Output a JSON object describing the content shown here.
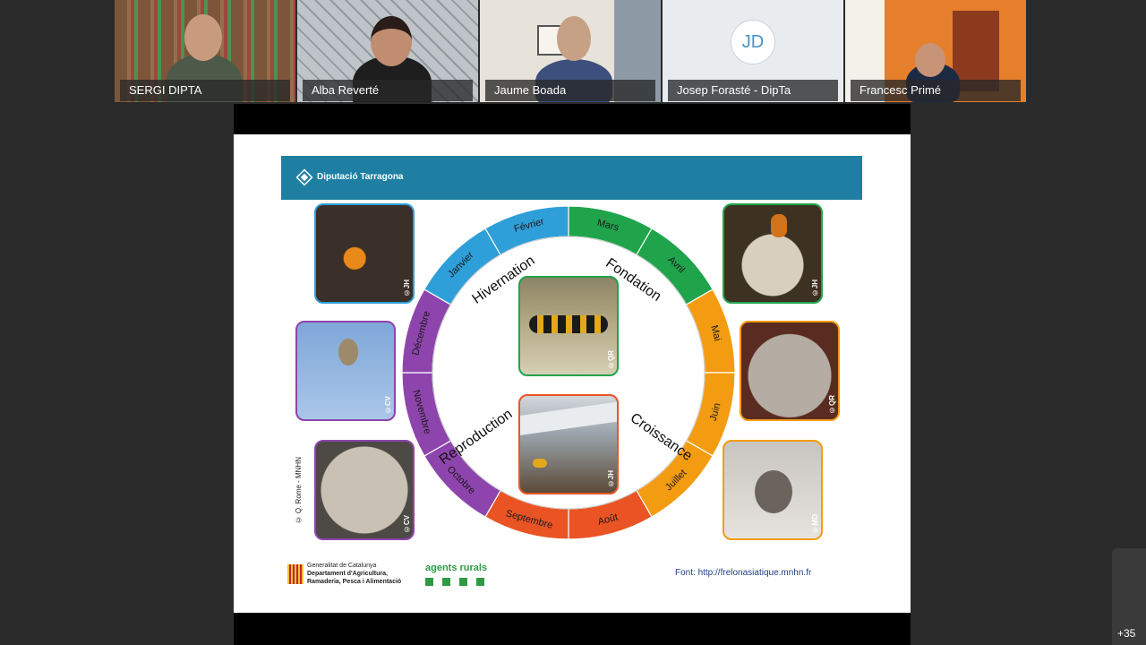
{
  "participants": [
    {
      "name": "SERGI DIPTA"
    },
    {
      "name": "Alba Reverté"
    },
    {
      "name": "Jaume Boada"
    },
    {
      "name": "Josep Forasté - DipTa",
      "initials": "JD"
    },
    {
      "name": "Francesc Primé"
    }
  ],
  "overflow_count": "+35",
  "slide": {
    "banner": "Diputació Tarragona",
    "months": [
      "Mars",
      "Avril",
      "Mai",
      "Juin",
      "Juillet",
      "Août",
      "Septembre",
      "Octobre",
      "Novembre",
      "Décembre",
      "Janvier",
      "Février"
    ],
    "phases": [
      "Fondation",
      "Croissance",
      "Reproduction",
      "Hivernation"
    ],
    "photo_credits": [
      "©JH",
      "©CV",
      "©CV",
      "©JH",
      "©QR",
      "©MD",
      "©QR",
      "©JH"
    ],
    "side_credit": "© Q. Rome - MNHN",
    "footer_gov": [
      "Generalitat de Catalunya",
      "Departament d'Agricultura,",
      "Ramaderia, Pesca i Alimentació"
    ],
    "footer_agents": "agents rurals",
    "source": "Font: http://frelonasiatique.mnhn.fr"
  },
  "colors": {
    "green": "#1fa44b",
    "orange": "#f39c12",
    "red": "#ea5424",
    "purple": "#8e44ad",
    "blue": "#2e9fd8",
    "banner": "#1f7fa3"
  }
}
